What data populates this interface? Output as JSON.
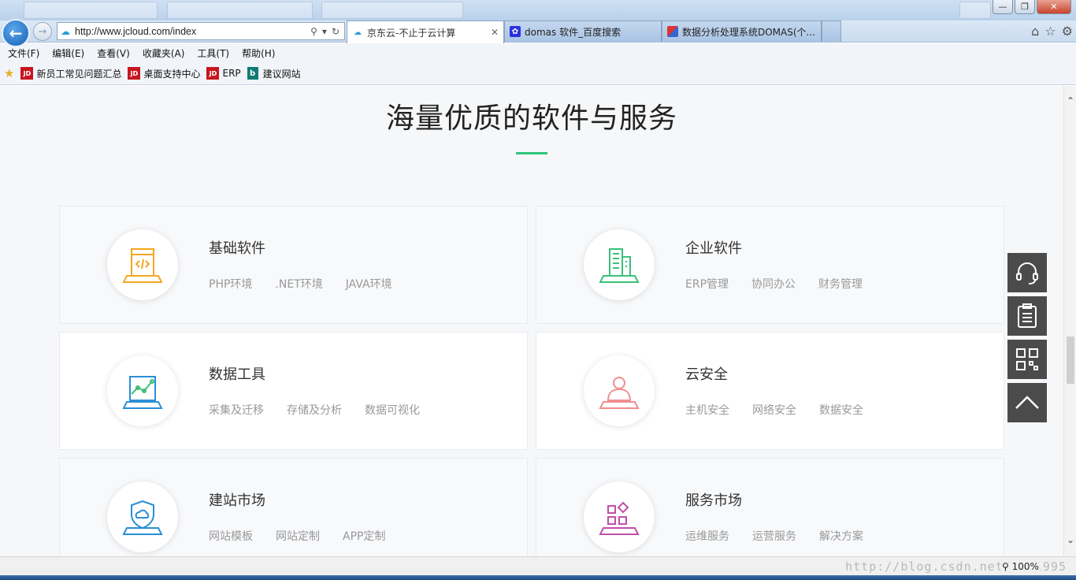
{
  "browser": {
    "address_url": "http://www.jcloud.com/index",
    "tabs": [
      {
        "label": "京东云-不止于云计算",
        "active": true,
        "icon": "cloud-icon"
      },
      {
        "label": "domas 软件_百度搜索",
        "active": false,
        "icon": "baidu-paw-icon"
      },
      {
        "label": "数据分析处理系统DOMAS(个...",
        "active": false,
        "icon": "domas-icon"
      }
    ],
    "menu": [
      "文件(F)",
      "编辑(E)",
      "查看(V)",
      "收藏夹(A)",
      "工具(T)",
      "帮助(H)"
    ],
    "favorites": [
      {
        "label": "新员工常见问题汇总",
        "icon": "jd"
      },
      {
        "label": "桌面支持中心",
        "icon": "jd"
      },
      {
        "label": "ERP",
        "icon": "jd"
      },
      {
        "label": "建议网站",
        "icon": "bing"
      }
    ],
    "zoom": "100%",
    "watermark": "http://blog.csdn.net/...1995"
  },
  "section": {
    "title": "海量优质的软件与服务",
    "accent": "#2cc47b"
  },
  "cards": [
    {
      "title": "基础软件",
      "links": [
        "PHP环境",
        ".NET环境",
        "JAVA环境"
      ],
      "icon": "code-window-icon",
      "color": "#f5a623"
    },
    {
      "title": "企业软件",
      "links": [
        "ERP管理",
        "协同办公",
        "财务管理"
      ],
      "icon": "building-icon",
      "color": "#3cc07a"
    },
    {
      "title": "数据工具",
      "links": [
        "采集及迁移",
        "存储及分析",
        "数据可视化"
      ],
      "icon": "chart-monitor-icon",
      "color": "#2a8fd6"
    },
    {
      "title": "云安全",
      "links": [
        "主机安全",
        "网络安全",
        "数据安全"
      ],
      "icon": "user-security-icon",
      "color": "#f08f8f"
    },
    {
      "title": "建站市场",
      "links": [
        "网站模板",
        "网站定制",
        "APP定制"
      ],
      "icon": "shield-cloud-icon",
      "color": "#2a8fd6"
    },
    {
      "title": "服务市场",
      "links": [
        "运维服务",
        "运营服务",
        "解决方案"
      ],
      "icon": "blocks-icon",
      "color": "#c04fa8"
    }
  ],
  "side_tools": [
    "headset-icon",
    "clipboard-icon",
    "qrcode-icon",
    "back-to-top-icon"
  ]
}
